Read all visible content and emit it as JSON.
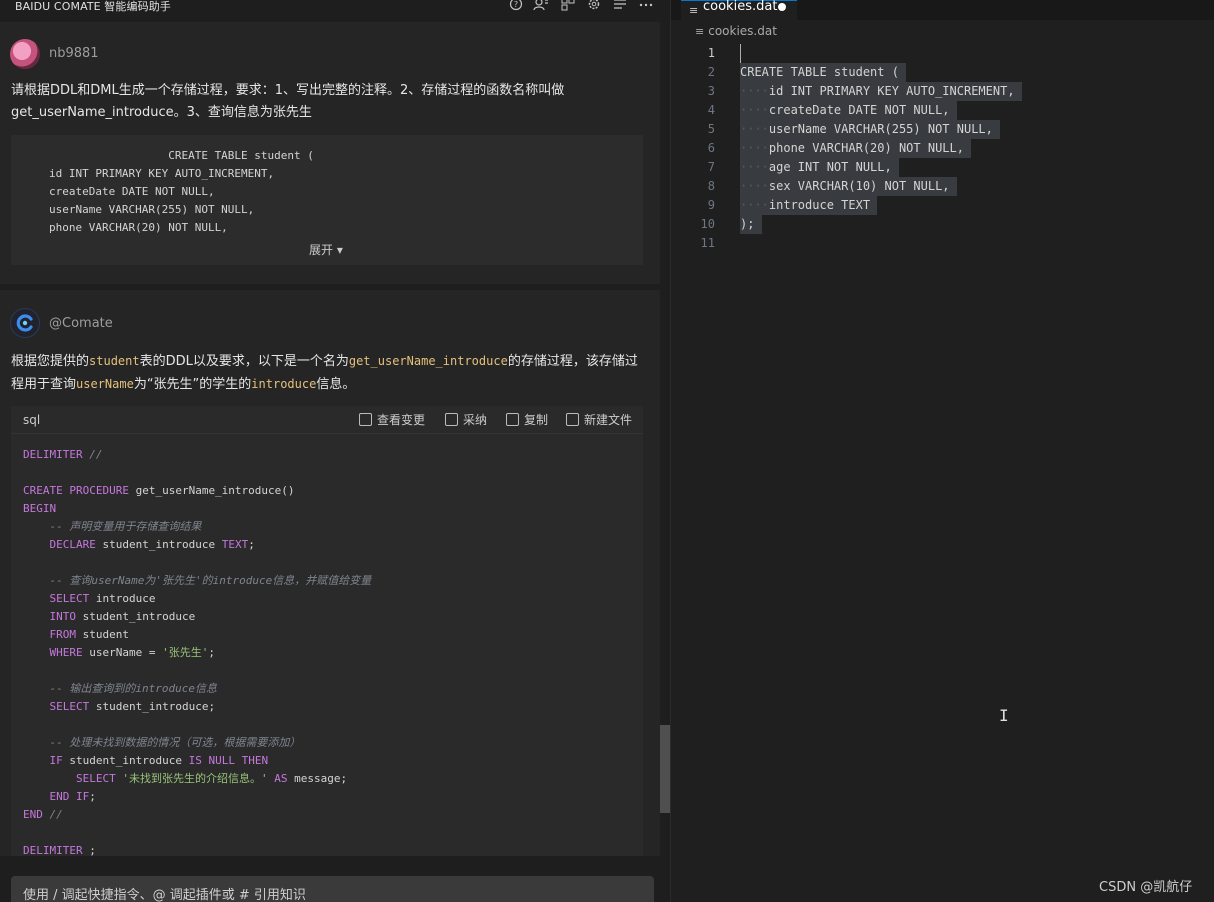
{
  "left_panel": {
    "title": "BAIDU COMATE 智能编码助手",
    "toolbar_icons": [
      "help-icon",
      "account-icon",
      "layout-icon",
      "gear-icon",
      "list-icon",
      "more-icon"
    ],
    "user_message": {
      "username": "nb9881",
      "text_line1": "请根据DDL和DML生成一个存储过程，要求：1、写出完整的注释。2、存储过程的函数名称叫做",
      "text_line2": "get_userName_introduce。3、查询信息为张先生",
      "quoted_code": [
        "                  CREATE TABLE student (",
        "id INT PRIMARY KEY AUTO_INCREMENT,",
        "createDate DATE NOT NULL,",
        "userName VARCHAR(255) NOT NULL,",
        "phone VARCHAR(20) NOT NULL,"
      ],
      "expand_label": "展开 ▾"
    },
    "bot_message": {
      "name": "@Comate",
      "text_a": "根据您提供的",
      "text_b": "student",
      "text_c": "表的DDL以及要求，以下是一个名为",
      "text_d": "get_userName_introduce",
      "text_e": "的存储过程，该存储过",
      "text_f": "程用于查询",
      "text_g": "userName",
      "text_h": "为“张先生”的学生的",
      "text_i": "introduce",
      "text_j": "信息。",
      "code_lang": "sql",
      "actions": {
        "view_changes": "查看变更",
        "adopt": "采纳",
        "copy": "复制",
        "new_file": "新建文件"
      },
      "code_lines": [
        [
          {
            "t": "kw",
            "v": "DELIMITER"
          },
          {
            "t": "",
            "v": " "
          },
          {
            "t": "cm",
            "v": "//"
          }
        ],
        [],
        [
          {
            "t": "kw",
            "v": "CREATE PROCEDURE"
          },
          {
            "t": "",
            "v": " get_userName_introduce()"
          }
        ],
        [
          {
            "t": "kw",
            "v": "BEGIN"
          }
        ],
        [
          {
            "t": "",
            "v": "    "
          },
          {
            "t": "cm",
            "v": "-- 声明变量用于存储查询结果"
          }
        ],
        [
          {
            "t": "",
            "v": "    "
          },
          {
            "t": "kw",
            "v": "DECLARE"
          },
          {
            "t": "",
            "v": " student_introduce "
          },
          {
            "t": "kw",
            "v": "TEXT"
          },
          {
            "t": "",
            "v": ";"
          }
        ],
        [],
        [
          {
            "t": "",
            "v": "    "
          },
          {
            "t": "cm",
            "v": "-- 查询userName为'张先生'的introduce信息，并赋值给变量"
          }
        ],
        [
          {
            "t": "",
            "v": "    "
          },
          {
            "t": "kw",
            "v": "SELECT"
          },
          {
            "t": "",
            "v": " introduce"
          }
        ],
        [
          {
            "t": "",
            "v": "    "
          },
          {
            "t": "kw",
            "v": "INTO"
          },
          {
            "t": "",
            "v": " student_introduce"
          }
        ],
        [
          {
            "t": "",
            "v": "    "
          },
          {
            "t": "kw",
            "v": "FROM"
          },
          {
            "t": "",
            "v": " student"
          }
        ],
        [
          {
            "t": "",
            "v": "    "
          },
          {
            "t": "kw",
            "v": "WHERE"
          },
          {
            "t": "",
            "v": " userName = "
          },
          {
            "t": "st",
            "v": "'张先生'"
          },
          {
            "t": "",
            "v": ";"
          }
        ],
        [],
        [
          {
            "t": "",
            "v": "    "
          },
          {
            "t": "cm",
            "v": "-- 输出查询到的introduce信息"
          }
        ],
        [
          {
            "t": "",
            "v": "    "
          },
          {
            "t": "kw",
            "v": "SELECT"
          },
          {
            "t": "",
            "v": " student_introduce;"
          }
        ],
        [],
        [
          {
            "t": "",
            "v": "    "
          },
          {
            "t": "cm",
            "v": "-- 处理未找到数据的情况（可选，根据需要添加）"
          }
        ],
        [
          {
            "t": "",
            "v": "    "
          },
          {
            "t": "kw",
            "v": "IF"
          },
          {
            "t": "",
            "v": " student_introduce "
          },
          {
            "t": "kw",
            "v": "IS NULL THEN"
          }
        ],
        [
          {
            "t": "",
            "v": "        "
          },
          {
            "t": "kw",
            "v": "SELECT"
          },
          {
            "t": "",
            "v": " "
          },
          {
            "t": "st",
            "v": "'未找到张先生的介绍信息。'"
          },
          {
            "t": "",
            "v": " "
          },
          {
            "t": "kw",
            "v": "AS"
          },
          {
            "t": "",
            "v": " message;"
          }
        ],
        [
          {
            "t": "",
            "v": "    "
          },
          {
            "t": "kw",
            "v": "END IF"
          },
          {
            "t": "",
            "v": ";"
          }
        ],
        [
          {
            "t": "kw",
            "v": "END"
          },
          {
            "t": "",
            "v": " "
          },
          {
            "t": "cm",
            "v": "//"
          }
        ],
        [],
        [
          {
            "t": "kw",
            "v": "DELIMITER"
          },
          {
            "t": "",
            "v": " ;"
          }
        ]
      ]
    },
    "input_placeholder": "使用 / 调起快捷指令、@ 调起插件或 # 引用知识"
  },
  "editor": {
    "tab_label": "cookies.dat",
    "breadcrumb": "cookies.dat",
    "lines": [
      "",
      "CREATE TABLE student (",
      "    id INT PRIMARY KEY AUTO_INCREMENT,",
      "    createDate DATE NOT NULL,",
      "    userName VARCHAR(255) NOT NULL,",
      "    phone VARCHAR(20) NOT NULL,",
      "    age INT NOT NULL,",
      "    sex VARCHAR(10) NOT NULL,",
      "    introduce TEXT",
      ");",
      ""
    ]
  },
  "watermark": "CSDN @凯航仔"
}
